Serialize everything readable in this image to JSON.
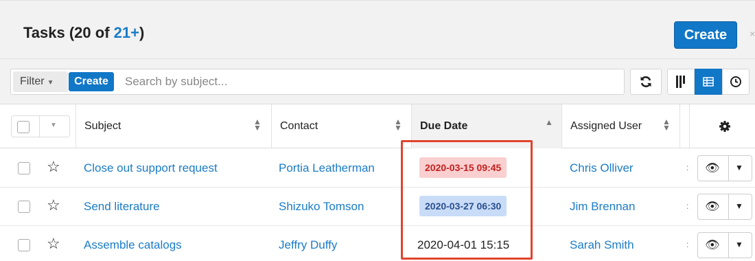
{
  "header": {
    "title_prefix": "Tasks (20 of ",
    "title_count": "21+",
    "title_suffix": ")",
    "create_label": "Create",
    "close_glyph": "×"
  },
  "filterbar": {
    "filter_label": "Filter",
    "create_label": "Create",
    "search_placeholder": "Search by subject...",
    "icons": [
      "refresh-icon",
      "column-view-icon",
      "list-view-icon",
      "activity-stream-icon"
    ]
  },
  "table": {
    "columns": [
      {
        "label": "Subject",
        "sort": "both"
      },
      {
        "label": "Contact",
        "sort": "both"
      },
      {
        "label": "Due Date",
        "sort": "asc"
      },
      {
        "label": "Assigned User",
        "sort": "both"
      }
    ],
    "rows": [
      {
        "subject": "Close out support request",
        "contact": "Portia Leatherman",
        "due_date": "2020-03-15 09:45",
        "due_status": "overdue",
        "assigned_user": "Chris Olliver"
      },
      {
        "subject": "Send literature",
        "contact": "Shizuko Tomson",
        "due_date": "2020-03-27 06:30",
        "due_status": "soon",
        "assigned_user": "Jim Brennan"
      },
      {
        "subject": "Assemble catalogs",
        "contact": "Jeffry Duffy",
        "due_date": "2020-04-01 15:15",
        "due_status": "normal",
        "assigned_user": "Sarah Smith"
      }
    ]
  },
  "colors": {
    "accent": "#1177c7",
    "overdue_bg": "#f9cfcf",
    "overdue_text": "#c52020",
    "soon_bg": "#c9dcf7",
    "highlight": "#e0432e"
  }
}
